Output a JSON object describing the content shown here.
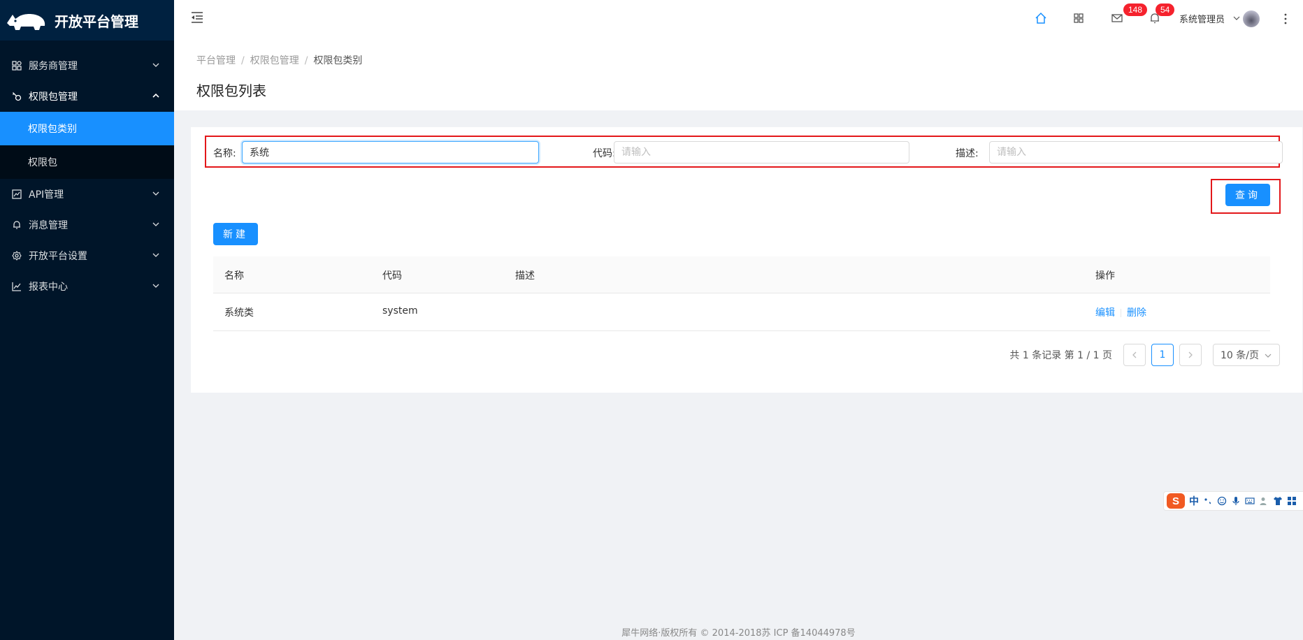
{
  "app": {
    "title": "开放平台管理"
  },
  "sidebar": {
    "items": [
      {
        "label": "服务商管理",
        "icon": "appstore-icon",
        "open": false
      },
      {
        "label": "权限包管理",
        "icon": "key-icon",
        "open": true,
        "children": [
          {
            "label": "权限包类别",
            "active": true
          },
          {
            "label": "权限包",
            "active": false
          }
        ]
      },
      {
        "label": "API管理",
        "icon": "api-icon",
        "open": false
      },
      {
        "label": "消息管理",
        "icon": "bell-icon",
        "open": false
      },
      {
        "label": "开放平台设置",
        "icon": "setting-icon",
        "open": false
      },
      {
        "label": "报表中心",
        "icon": "line-chart-icon",
        "open": false
      }
    ]
  },
  "topbar": {
    "mail_count": "148",
    "bell_count": "54",
    "user_name": "系统管理员"
  },
  "breadcrumb": [
    "平台管理",
    "权限包管理",
    "权限包类别"
  ],
  "page_title": "权限包列表",
  "filters": {
    "name_label": "名称:",
    "name_value": "系统",
    "code_label": "代码:",
    "code_placeholder": "请输入",
    "desc_label": "描述:",
    "desc_placeholder": "请输入"
  },
  "buttons": {
    "query": "查询",
    "new": "新建"
  },
  "table": {
    "columns": [
      "名称",
      "代码",
      "描述",
      "操作"
    ],
    "rows": [
      {
        "name": "系统类",
        "code": "system",
        "desc": "",
        "edit": "编辑",
        "delete": "删除"
      }
    ]
  },
  "pagination": {
    "summary": "共 1 条记录 第 1 / 1 页",
    "current": "1",
    "page_size": "10 条/页"
  },
  "ime": {
    "label": "中"
  },
  "footer": "犀牛网络·版权所有 © 2014-2018苏 ICP 备14044978号",
  "colors": {
    "primary": "#1890ff",
    "sidebar": "#001529",
    "highlight_box": "#e3171a"
  }
}
